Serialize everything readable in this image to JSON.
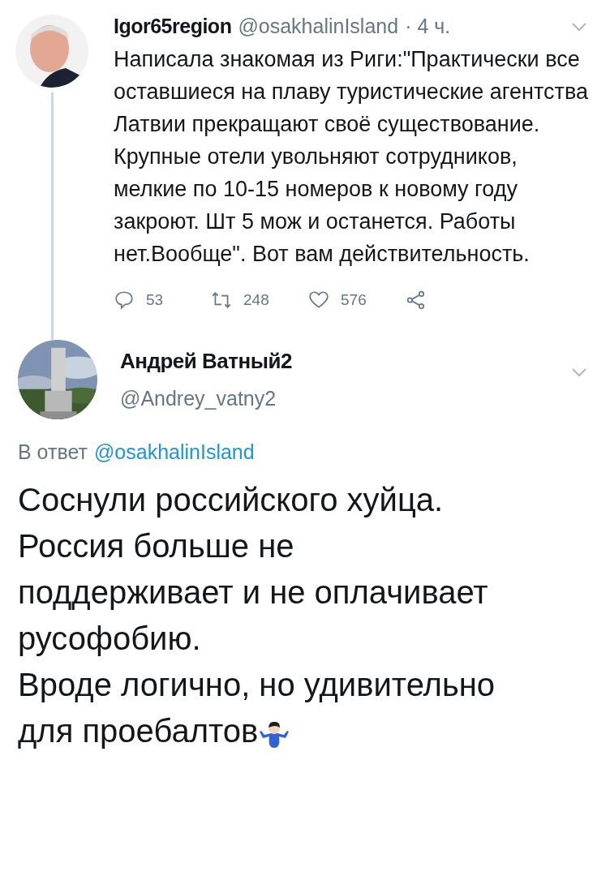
{
  "tweet": {
    "name": "Igor65region",
    "handle": "@osakhalinIsland",
    "time": "· 4 ч.",
    "text": "Написала знакомая из Риги:\"Практически все оставшиеся на плаву туристические агентства Латвии прекращают своё существование. Крупные отели увольняют сотрудников, мелкие по 10-15 номеров к новому году закроют. Шт 5 мож и останется. Работы нет.Вообще\". Вот вам действительность.",
    "actions": [
      {
        "kind": "reply",
        "count": "53"
      },
      {
        "kind": "retweet",
        "count": "248"
      },
      {
        "kind": "like",
        "count": "576"
      },
      {
        "kind": "share"
      }
    ]
  },
  "reply": {
    "name": "Андрей Ватный2",
    "handle": "@Andrey_vatny2",
    "reply_to_label": "В ответ",
    "reply_to": "@osakhalinIsland",
    "lines": [
      "Соснули российского хуйца.",
      "Россия больше не",
      "поддерживает и не оплачивает",
      "русофобию.",
      "Вроде логично, но удивительно",
      "для проебалтов"
    ]
  }
}
